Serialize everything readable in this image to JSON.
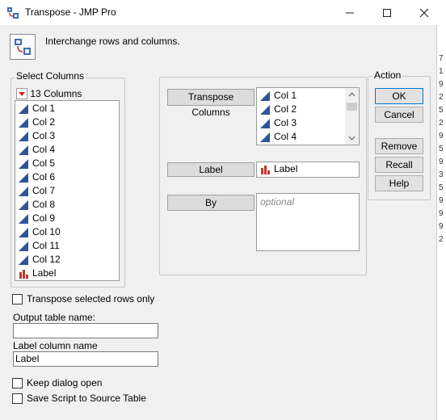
{
  "window": {
    "title": "Transpose - JMP Pro",
    "minimize_icon": "minimize-icon",
    "maximize_icon": "maximize-icon",
    "close_icon": "close-icon"
  },
  "header": {
    "icon": "transpose-icon",
    "description": "Interchange rows and columns."
  },
  "select_columns": {
    "title": "Select Columns",
    "count_label": "13 Columns",
    "items": [
      {
        "label": "Col 1",
        "icon": "continuous-icon"
      },
      {
        "label": "Col 2",
        "icon": "continuous-icon"
      },
      {
        "label": "Col 3",
        "icon": "continuous-icon"
      },
      {
        "label": "Col 4",
        "icon": "continuous-icon"
      },
      {
        "label": "Col 5",
        "icon": "continuous-icon"
      },
      {
        "label": "Col 6",
        "icon": "continuous-icon"
      },
      {
        "label": "Col 7",
        "icon": "continuous-icon"
      },
      {
        "label": "Col 8",
        "icon": "continuous-icon"
      },
      {
        "label": "Col 9",
        "icon": "continuous-icon"
      },
      {
        "label": "Col 10",
        "icon": "continuous-icon"
      },
      {
        "label": "Col 11",
        "icon": "continuous-icon"
      },
      {
        "label": "Col 12",
        "icon": "continuous-icon"
      },
      {
        "label": "Label",
        "icon": "nominal-icon"
      }
    ]
  },
  "roles": {
    "transpose_columns": {
      "button_label": "Transpose Columns",
      "items": [
        "Col 1",
        "Col 2",
        "Col 3",
        "Col 4"
      ]
    },
    "label": {
      "button_label": "Label",
      "value": "Label"
    },
    "by": {
      "button_label": "By",
      "placeholder": "optional"
    }
  },
  "action": {
    "title": "Action",
    "ok": "OK",
    "cancel": "Cancel",
    "remove": "Remove",
    "recall": "Recall",
    "help": "Help"
  },
  "options": {
    "transpose_selected_rows_only": "Transpose selected rows only",
    "output_table_name_label": "Output table name:",
    "output_table_name_value": "",
    "label_column_name_label": "Label column name",
    "label_column_name_value": "Label",
    "keep_dialog_open": "Keep dialog open",
    "save_script": "Save Script to Source Table"
  },
  "background_window_chars": [
    "7",
    "1",
    "9",
    "2",
    "5",
    "2",
    "9",
    "5",
    "9",
    "3",
    "5",
    "9",
    "9",
    "9",
    "2"
  ],
  "colors": {
    "continuous_icon": "#2f5597",
    "nominal_icon": "#c0392b",
    "default_button_border": "#0078d7"
  }
}
